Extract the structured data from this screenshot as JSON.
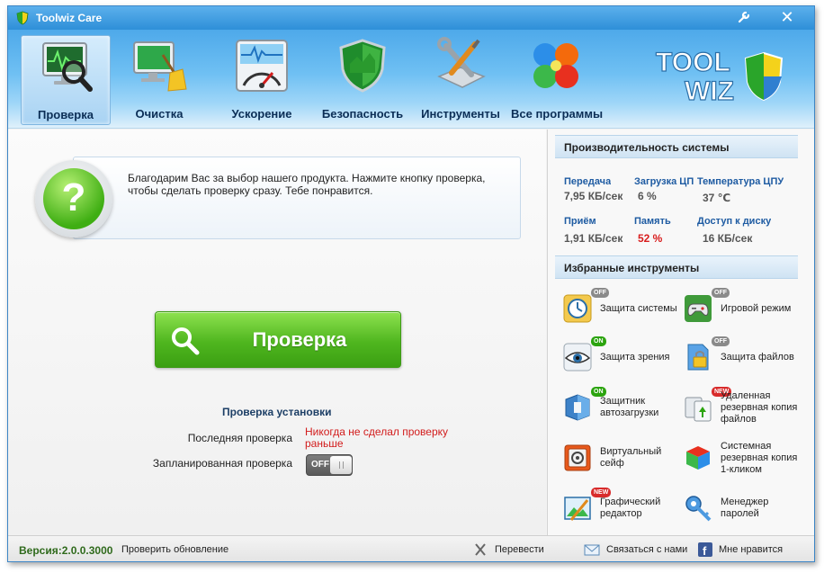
{
  "window": {
    "title": "Toolwiz Care"
  },
  "nav": [
    {
      "label": "Проверка",
      "icon": "monitor-magnifier-icon",
      "active": true
    },
    {
      "label": "Очистка",
      "icon": "monitor-broom-icon"
    },
    {
      "label": "Ускорение",
      "icon": "speedometer-icon"
    },
    {
      "label": "Безопасность",
      "icon": "shield-icon"
    },
    {
      "label": "Инструменты",
      "icon": "tools-icon"
    },
    {
      "label": "Все программы",
      "icon": "apps-grid-icon"
    }
  ],
  "brand": {
    "line1": "TOOL",
    "line2": "WIZ"
  },
  "message": {
    "text": "Благодарим Вас за выбор нашего продукта. Нажмите кнопку проверка, чтобы сделать проверку сразу. Тебе понравится.",
    "icon": "question-mark-icon"
  },
  "scan": {
    "label": "Проверка"
  },
  "settings": {
    "title": "Проверка установки",
    "last_label": "Последняя проверка",
    "last_value": "Никогда не сделал проверку раньше",
    "scheduled_label": "Запланированная проверка",
    "scheduled_toggle": "OFF"
  },
  "performance": {
    "title": "Производительность системы",
    "upload_label": "Передача",
    "upload_value": "7,95 КБ/сек",
    "cpu_label": "Загрузка ЦП",
    "cpu_value": "6 %",
    "temp_label": "Температура ЦПУ",
    "temp_value": "37 ℃",
    "download_label": "Приём",
    "download_value": "1,91 КБ/сек",
    "memory_label": "Память",
    "memory_value": "52 %",
    "disk_label": "Доступ к диску",
    "disk_value": "16 КБ/сек"
  },
  "favorites": {
    "title": "Избранные инструменты",
    "items": [
      {
        "label": "Защита системы",
        "badge": "OFF",
        "icon": "system-protect-icon"
      },
      {
        "label": "Игровой режим",
        "badge": "OFF",
        "icon": "gamepad-icon"
      },
      {
        "label": "Защита зрения",
        "badge": "ON",
        "icon": "eye-icon"
      },
      {
        "label": "Защита файлов",
        "badge": "OFF",
        "icon": "file-lock-icon"
      },
      {
        "label": "Защитник автозагрузки",
        "badge": "ON",
        "icon": "startup-guard-icon"
      },
      {
        "label": "Удаленная резервная копия файлов",
        "badge": "NEW",
        "icon": "remote-backup-icon"
      },
      {
        "label": "Виртуальный сейф",
        "badge": "",
        "icon": "safe-icon"
      },
      {
        "label": "Системная резервная копия 1-кликом",
        "badge": "",
        "icon": "system-backup-icon"
      },
      {
        "label": "Графический редактор",
        "badge": "NEW",
        "icon": "image-editor-icon"
      },
      {
        "label": "Менеджер паролей",
        "badge": "",
        "icon": "key-icon"
      }
    ]
  },
  "status": {
    "version": "Версия:2.0.0.3000",
    "check_update": "Проверить обновление",
    "translate": "Перевести",
    "contact": "Связаться с нами",
    "like": "Мне нравится"
  },
  "colors": {
    "accent": "#2e8fd8",
    "scan_green": "#4fb61f",
    "warning_red": "#d21c1c"
  }
}
